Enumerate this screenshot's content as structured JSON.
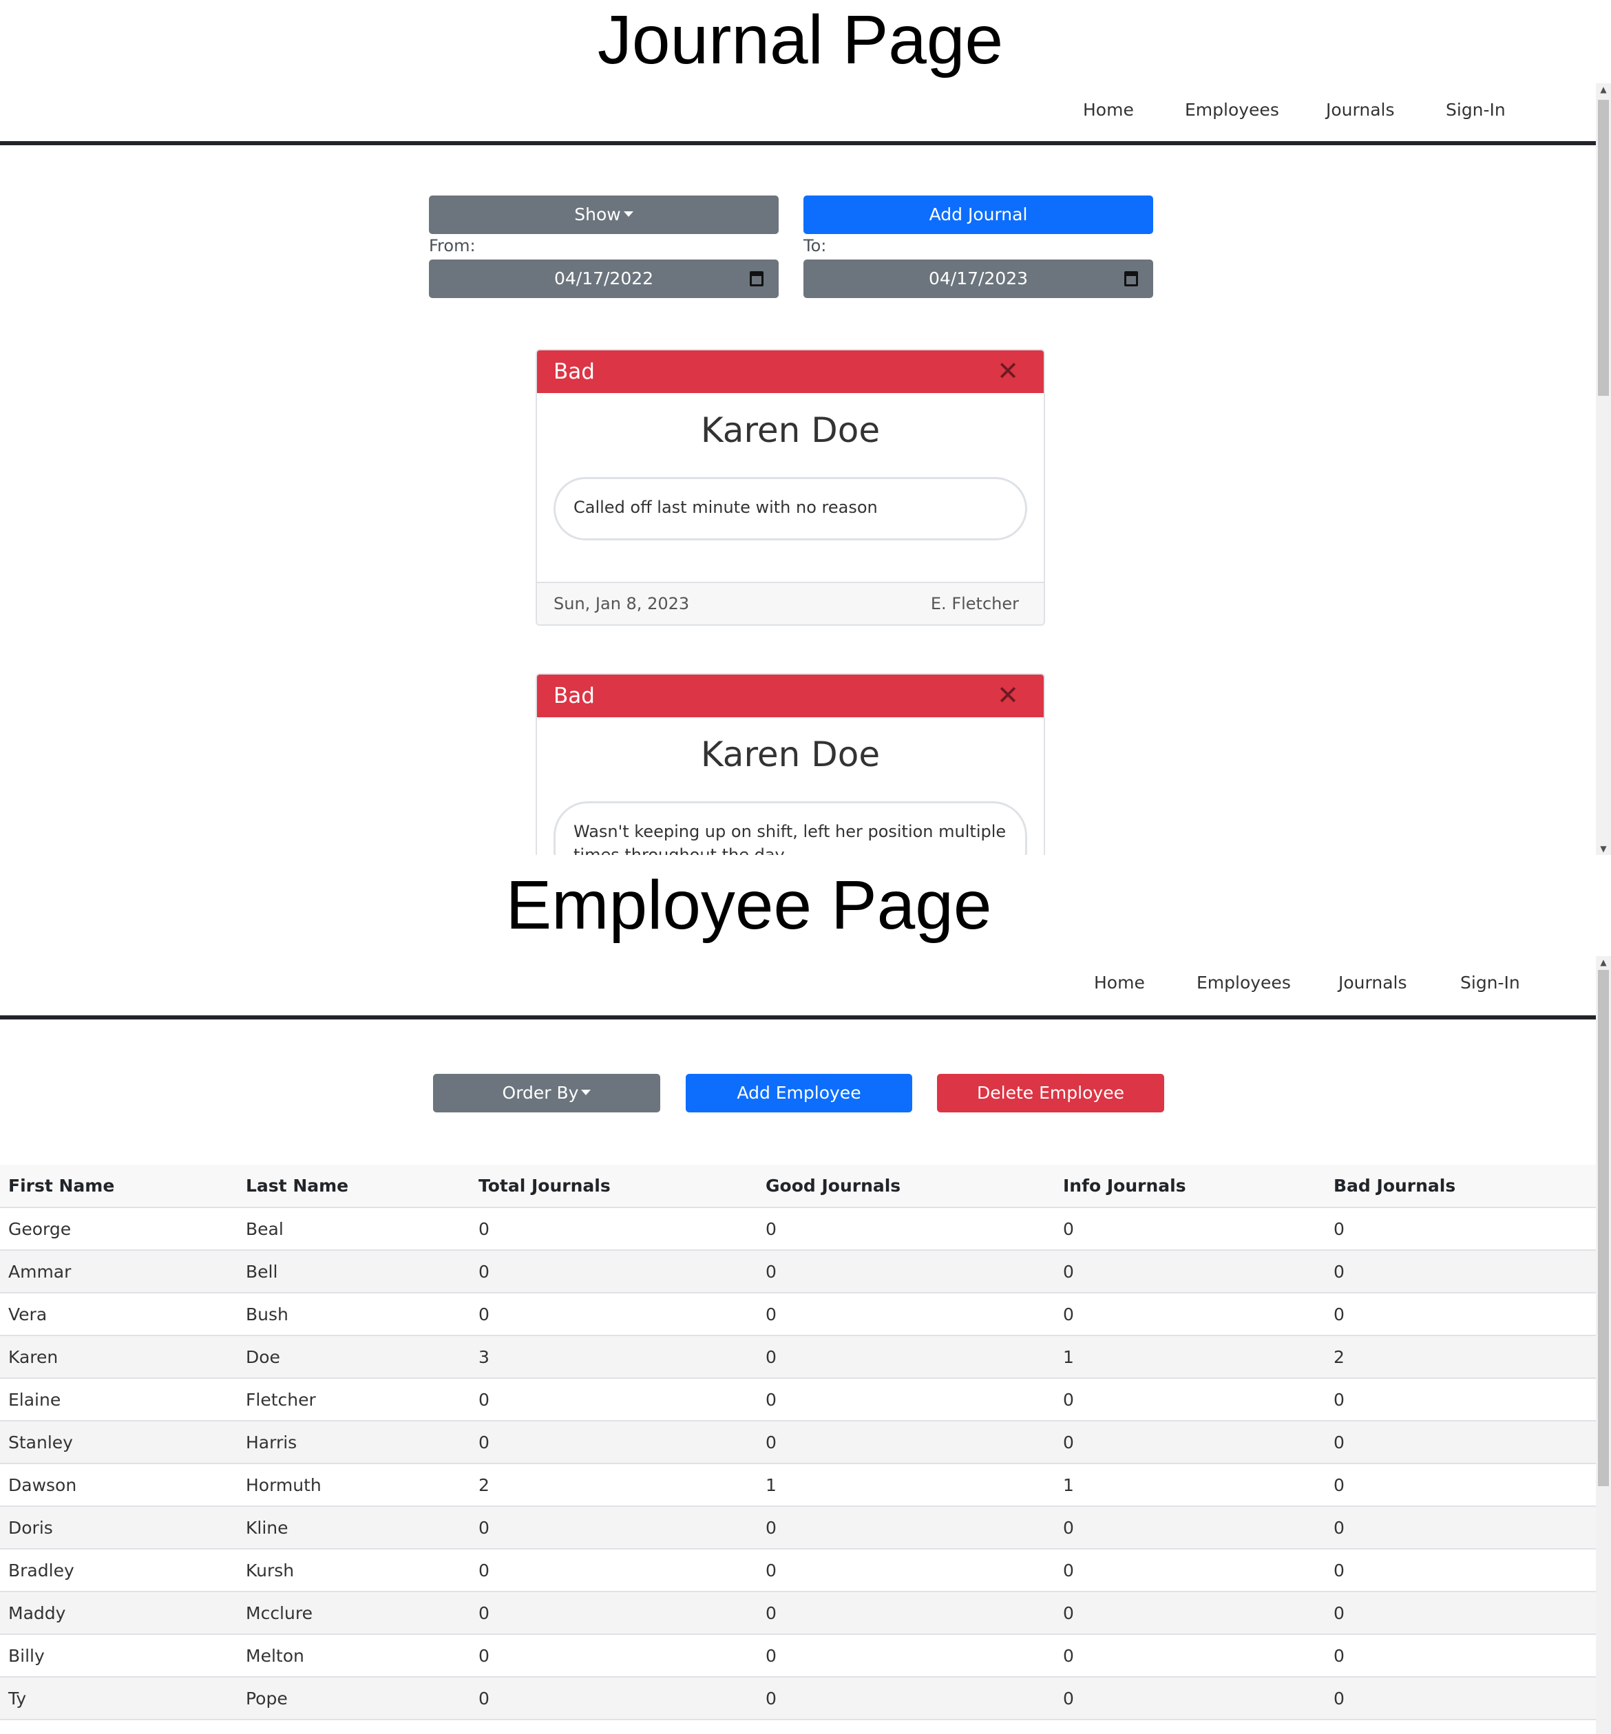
{
  "headings": {
    "journal_page": "Journal Page",
    "employee_page": "Employee Page"
  },
  "nav": {
    "home": "Home",
    "employees": "Employees",
    "journals": "Journals",
    "sign_in": "Sign-In"
  },
  "journal_page": {
    "show_button": "Show",
    "add_journal_button": "Add Journal",
    "from_label": "From:",
    "to_label": "To:",
    "from_date": "04/17/2022",
    "to_date": "04/17/2023",
    "cards": [
      {
        "type": "Bad",
        "name": "Karen Doe",
        "text": "Called off last minute with no reason",
        "date": "Sun, Jan 8, 2023",
        "author": "E. Fletcher"
      },
      {
        "type": "Bad",
        "name": "Karen Doe",
        "text": "Wasn't keeping up on shift, left her position multiple times throughout the day"
      }
    ]
  },
  "employee_page": {
    "order_by_button": "Order By",
    "add_employee_button": "Add Employee",
    "delete_employee_button": "Delete Employee",
    "columns": [
      "First Name",
      "Last Name",
      "Total Journals",
      "Good Journals",
      "Info Journals",
      "Bad Journals"
    ],
    "rows": [
      [
        "George",
        "Beal",
        "0",
        "0",
        "0",
        "0"
      ],
      [
        "Ammar",
        "Bell",
        "0",
        "0",
        "0",
        "0"
      ],
      [
        "Vera",
        "Bush",
        "0",
        "0",
        "0",
        "0"
      ],
      [
        "Karen",
        "Doe",
        "3",
        "0",
        "1",
        "2"
      ],
      [
        "Elaine",
        "Fletcher",
        "0",
        "0",
        "0",
        "0"
      ],
      [
        "Stanley",
        "Harris",
        "0",
        "0",
        "0",
        "0"
      ],
      [
        "Dawson",
        "Hormuth",
        "2",
        "1",
        "1",
        "0"
      ],
      [
        "Doris",
        "Kline",
        "0",
        "0",
        "0",
        "0"
      ],
      [
        "Bradley",
        "Kursh",
        "0",
        "0",
        "0",
        "0"
      ],
      [
        "Maddy",
        "Mcclure",
        "0",
        "0",
        "0",
        "0"
      ],
      [
        "Billy",
        "Melton",
        "0",
        "0",
        "0",
        "0"
      ],
      [
        "Ty",
        "Pope",
        "0",
        "0",
        "0",
        "0"
      ]
    ]
  },
  "colors": {
    "primary": "#0d6efd",
    "secondary": "#6c757d",
    "danger": "#dc3545"
  },
  "icons": [
    "caret-down-icon",
    "calendar-icon",
    "close-icon",
    "scroll-up-arrow-icon",
    "scroll-down-arrow-icon"
  ]
}
